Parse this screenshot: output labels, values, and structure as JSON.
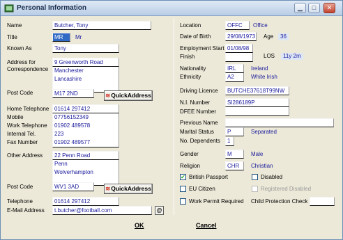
{
  "window": {
    "title": "Personal Information"
  },
  "left": {
    "name_label": "Name",
    "name": "Butcher, Tony",
    "title_label": "Title",
    "title_code": "MR",
    "title_text": "Mr",
    "known_as_label": "Known As",
    "known_as": "Tony",
    "address_label_1": "Address for",
    "address_label_2": "Correspondence",
    "address": [
      "9 Greenworth Road",
      "Manchester",
      "Lancashire",
      ""
    ],
    "post_code_label": "Post Code",
    "post_code": "M17 2ND",
    "quick_address_label": "QuickAddress",
    "home_tel_label": "Home Telephone",
    "home_tel": "01614 297412",
    "mobile_label": "Mobile",
    "mobile": "07756152349",
    "work_tel_label": "Work Telephone",
    "work_tel": "01902 489578",
    "internal_tel_label": "Internal Tel.",
    "internal_tel": "223",
    "fax_label": "Fax Number",
    "fax": "01902 489577",
    "other_address_label": "Other Address",
    "other_address": [
      "22 Penn Road",
      "Penn",
      "Wolverhampton",
      ""
    ],
    "other_post_code_label": "Post Code",
    "other_post_code": "WV1 3AD",
    "telephone_label": "Telephone",
    "telephone": "01614 297412",
    "email_label": "E-Mail Address",
    "email": "t.butcher@football.com",
    "email_btn": "@"
  },
  "right": {
    "location_label": "Location",
    "location_code": "OFFC",
    "location_text": "Office",
    "dob_label": "Date of Birth",
    "dob": "29/08/1973",
    "age_label": "Age",
    "age": "36",
    "emp_start_label": "Employment Start",
    "emp_start": "01/08/98",
    "finish_label": "Finish",
    "finish": "",
    "los_label": "LOS",
    "los": "11y 2m",
    "nationality_label": "Nationality",
    "nationality_code": "IRL",
    "nationality_text": "Ireland",
    "ethnicity_label": "Ethnicity",
    "ethnicity_code": "A2",
    "ethnicity_text": "White Irish",
    "driving_label": "Driving Licence",
    "driving": "BUTCHE37618T99NW",
    "ni_label": "N.I. Number",
    "ni": "SI286189P",
    "dfee_label": "DFEE Number",
    "dfee": "",
    "prev_name_label": "Previous Name",
    "prev_name": "",
    "marital_label": "Marital Status",
    "marital_code": "P",
    "marital_text": "Separated",
    "dependents_label": "No. Dependents",
    "dependents": "1",
    "gender_label": "Gender",
    "gender_code": "M",
    "gender_text": "Male",
    "religion_label": "Religion",
    "religion_code": "CHR",
    "religion_text": "Christian",
    "british_passport": "British Passport",
    "british_passport_mark": "✔",
    "disabled": "Disabled",
    "eu_citizen": "EU Citizen",
    "registered_disabled": "Registered Disabled",
    "work_permit": "Work Permit Required",
    "child_protection": "Child Protection Check",
    "child_protection_value": ""
  },
  "buttons": {
    "ok": "OK",
    "cancel": "Cancel"
  }
}
